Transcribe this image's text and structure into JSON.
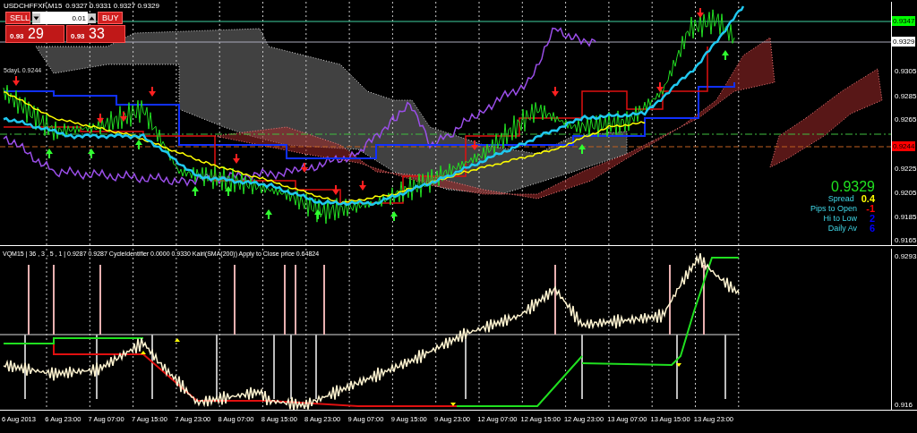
{
  "header": {
    "symbol": "USDCHFFXF,M15",
    "quotes": "0.9327 0.9331 0.9327 0.9329"
  },
  "trade_panel": {
    "sell_label": "SELL",
    "buy_label": "BUY",
    "lot": "0.01",
    "sell_price": {
      "prefix": "0.93",
      "main": "29"
    },
    "buy_price": {
      "prefix": "0.93",
      "main": "33"
    }
  },
  "chart_labels": [
    "5dayL 0.9244"
  ],
  "info": {
    "price": "0.9329",
    "rows": [
      {
        "label": "Spread",
        "value": "0.4",
        "color": "#ffff00"
      },
      {
        "label": "Pips to Open",
        "value": "-1",
        "color": "#ff0000"
      },
      {
        "label": "Hi to Low",
        "value": "2",
        "color": "#0000ff"
      },
      {
        "label": "Daily Av",
        "value": "6",
        "color": "#0000ff"
      }
    ]
  },
  "price_axis": [
    {
      "label": "0.9347",
      "kind": "marker",
      "color": "#00ff00"
    },
    {
      "label": "0.9329",
      "kind": "marker",
      "color": "#ffffff"
    },
    {
      "label": "0.9305",
      "kind": "tick"
    },
    {
      "label": "0.9285",
      "kind": "tick"
    },
    {
      "label": "0.9265",
      "kind": "tick"
    },
    {
      "label": "0.9244",
      "kind": "marker",
      "color": "#ff0000"
    },
    {
      "label": "0.9225",
      "kind": "tick"
    },
    {
      "label": "0.9205",
      "kind": "tick"
    },
    {
      "label": "0.9185",
      "kind": "tick"
    },
    {
      "label": "0.9165",
      "kind": "tick"
    }
  ],
  "indicator": {
    "title": "VQM15 | 36 , 3 , 5 , 1 | 0.9287 0.9287  CycleIdentifier 0.0000 0.9330  Kairi(SMA(200)) Apply to Close price 0.64824",
    "axis": [
      "0.9293",
      "0.916"
    ]
  },
  "time_axis": [
    "6 Aug 2013",
    "6 Aug 23:00",
    "7 Aug 07:00",
    "7 Aug 15:00",
    "7 Aug 23:00",
    "8 Aug 07:00",
    "8 Aug 15:00",
    "8 Aug 23:00",
    "9 Aug 07:00",
    "9 Aug 15:00",
    "9 Aug 23:00",
    "12 Aug 07:00",
    "12 Aug 15:00",
    "12 Aug 23:00",
    "13 Aug 07:00",
    "13 Aug 15:00",
    "13 Aug 23:00"
  ]
}
